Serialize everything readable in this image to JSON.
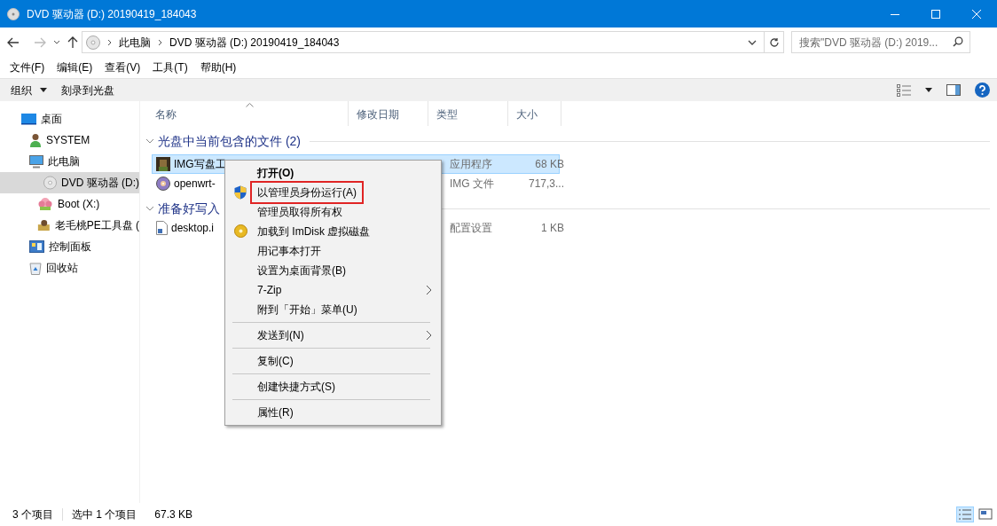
{
  "window": {
    "title": "DVD 驱动器 (D:) 20190419_184043"
  },
  "address_bar": {
    "breadcrumbs": [
      "此电脑",
      "DVD 驱动器 (D:) 20190419_184043"
    ]
  },
  "search": {
    "placeholder": "搜索\"DVD 驱动器 (D:) 2019..."
  },
  "menu_bar": [
    "文件(F)",
    "编辑(E)",
    "查看(V)",
    "工具(T)",
    "帮助(H)"
  ],
  "toolbar": {
    "buttons": [
      {
        "label": "组织",
        "dropdown": true
      },
      {
        "label": "刻录到光盘",
        "dropdown": false
      }
    ]
  },
  "sidebar": {
    "items": [
      {
        "label": "桌面",
        "kind": "desktop",
        "selected": false,
        "children": [
          {
            "label": "SYSTEM",
            "kind": "user",
            "selected": false
          },
          {
            "label": "此电脑",
            "kind": "pc",
            "selected": false,
            "children": [
              {
                "label": "DVD 驱动器 (D:)",
                "kind": "dvd",
                "selected": true
              },
              {
                "label": "Boot (X:)",
                "kind": "boot",
                "selected": false
              },
              {
                "label": "老毛桃PE工具盘 (",
                "kind": "usb",
                "selected": false
              }
            ]
          },
          {
            "label": "控制面板",
            "kind": "control",
            "selected": false
          },
          {
            "label": "回收站",
            "kind": "recycle",
            "selected": false
          }
        ]
      }
    ]
  },
  "file_list": {
    "columns": [
      "名称",
      "修改日期",
      "类型",
      "大小"
    ],
    "groups": [
      {
        "title": "光盘中当前包含的文件 (2)",
        "files": [
          {
            "name": "IMG写盘工",
            "kind": "app",
            "type": "应用程序",
            "size": "68 KB",
            "selected": true
          },
          {
            "name": "openwrt-",
            "kind": "image",
            "type": "IMG 文件",
            "size": "717,3...",
            "selected": false
          }
        ]
      },
      {
        "title": "准备好写入",
        "files": [
          {
            "name": "desktop.i",
            "kind": "config",
            "type": "配置设置",
            "size": "1 KB",
            "selected": false
          }
        ]
      }
    ]
  },
  "context_menu": {
    "items": [
      {
        "kind": "plain",
        "label": "打开(O)",
        "default": true,
        "submenu": false,
        "highlighted": false
      },
      {
        "kind": "admin",
        "label": "以管理员身份运行(A)",
        "default": false,
        "submenu": false,
        "highlighted": true
      },
      {
        "kind": "plain",
        "label": "管理员取得所有权",
        "default": false,
        "submenu": false,
        "highlighted": false
      },
      {
        "kind": "mount",
        "label": "加载到 ImDisk 虚拟磁盘",
        "default": false,
        "submenu": false,
        "highlighted": false
      },
      {
        "kind": "plain",
        "label": "用记事本打开",
        "default": false,
        "submenu": false,
        "highlighted": false
      },
      {
        "kind": "plain",
        "label": "设置为桌面背景(B)",
        "default": false,
        "submenu": false,
        "highlighted": false
      },
      {
        "kind": "plain",
        "label": "7-Zip",
        "default": false,
        "submenu": true,
        "highlighted": false
      },
      {
        "kind": "plain",
        "label": "附到「开始」菜单(U)",
        "default": false,
        "submenu": false,
        "highlighted": false
      },
      {
        "kind": "separator"
      },
      {
        "kind": "plain",
        "label": "发送到(N)",
        "default": false,
        "submenu": true,
        "highlighted": false
      },
      {
        "kind": "separator"
      },
      {
        "kind": "plain",
        "label": "复制(C)",
        "default": false,
        "submenu": false,
        "highlighted": false
      },
      {
        "kind": "separator"
      },
      {
        "kind": "plain",
        "label": "创建快捷方式(S)",
        "default": false,
        "submenu": false,
        "highlighted": false
      },
      {
        "kind": "separator"
      },
      {
        "kind": "plain",
        "label": "属性(R)",
        "default": false,
        "submenu": false,
        "highlighted": false
      }
    ]
  },
  "status_bar": {
    "item_count": "3 个项目",
    "selection": "选中 1 个项目",
    "size": "67.3 KB"
  }
}
